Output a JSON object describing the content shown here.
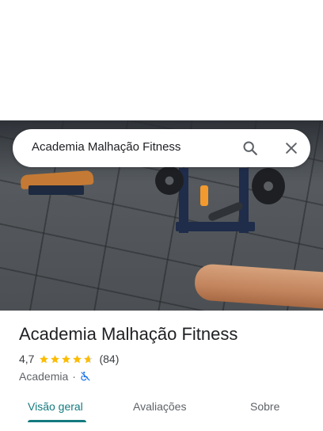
{
  "search": {
    "query": "Academia Malhação Fitness"
  },
  "place": {
    "name": "Academia Malhação Fitness",
    "rating": "4,7",
    "stars": 4.7,
    "review_count": "(84)",
    "category": "Academia",
    "separator": "·"
  },
  "tabs": [
    {
      "label": "Visão geral",
      "active": true
    },
    {
      "label": "Avaliações",
      "active": false
    },
    {
      "label": "Sobre",
      "active": false
    }
  ],
  "colors": {
    "accent": "#137a7f",
    "star": "#fbbc04",
    "text": "#202124",
    "secondary": "#5f6368",
    "wheelchair_icon": "#1a73e8"
  },
  "icons": {
    "search": "search-icon",
    "close": "close-icon",
    "accessibility": "no-wheelchair-icon"
  }
}
